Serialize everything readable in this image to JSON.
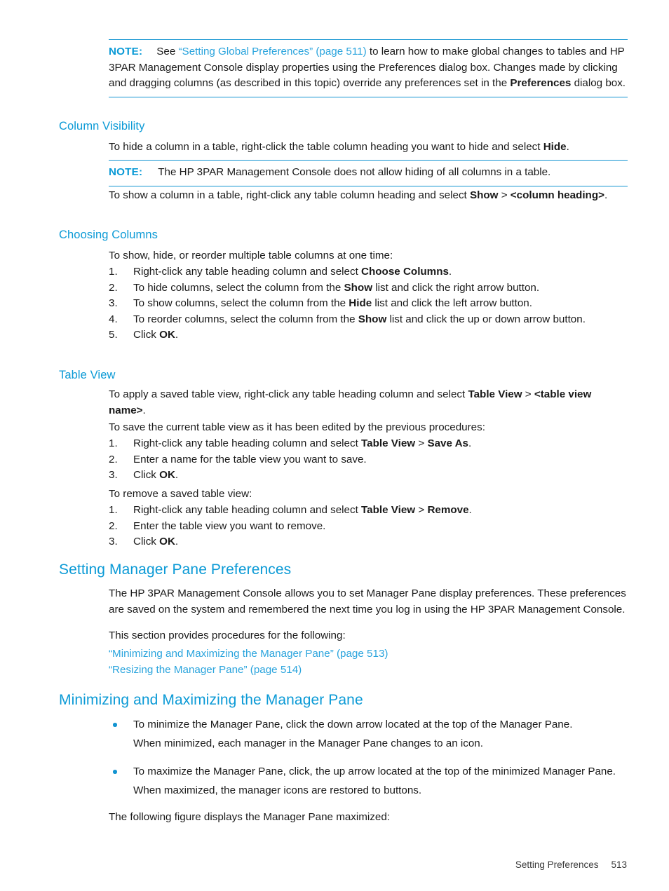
{
  "page": {
    "footer_section": "Setting Preferences",
    "footer_page_number": "513",
    "accent_blue": "#0b9ad6",
    "link_blue": "#2aa4dd",
    "rule_blue": "#1294d1"
  },
  "note_top": {
    "label": "NOTE:",
    "lead": "See ",
    "link": "“Setting Global Preferences” (page 511)",
    "rest": " to learn how to make global changes to tables and HP 3PAR Management Console display properties using the Preferences dialog box. Changes made by clicking and dragging columns (as described in this topic) override any preferences set in the ",
    "bold_term": "Preferences",
    "tail": " dialog box."
  },
  "column_visibility": {
    "heading": "Column Visibility",
    "para1_a": "To hide a column in a table, right-click the table column heading you want to hide and select ",
    "para1_bold": "Hide",
    "para1_b": ".",
    "note": {
      "label": "NOTE:",
      "text": "The HP 3PAR Management Console does not allow hiding of all columns in a table."
    },
    "para2_a": "To show a column in a table, right-click any table column heading and select ",
    "para2_bold1": "Show",
    "para2_mid": " > ",
    "para2_bold2": "<column heading>",
    "para2_b": "."
  },
  "choosing_columns": {
    "heading": "Choosing Columns",
    "intro": "To show, hide, or reorder multiple table columns at one time:",
    "steps": [
      {
        "num": "1.",
        "parts": [
          {
            "t": "Right-click any table heading column and select ",
            "b": false
          },
          {
            "t": "Choose Columns",
            "b": true
          },
          {
            "t": ".",
            "b": false
          }
        ]
      },
      {
        "num": "2.",
        "parts": [
          {
            "t": "To hide columns, select the column from the ",
            "b": false
          },
          {
            "t": "Show",
            "b": true
          },
          {
            "t": " list and click the right arrow button.",
            "b": false
          }
        ]
      },
      {
        "num": "3.",
        "parts": [
          {
            "t": "To show columns, select the column from the ",
            "b": false
          },
          {
            "t": "Hide",
            "b": true
          },
          {
            "t": " list and click the left arrow button.",
            "b": false
          }
        ]
      },
      {
        "num": "4.",
        "parts": [
          {
            "t": "To reorder columns, select the column from the ",
            "b": false
          },
          {
            "t": "Show",
            "b": true
          },
          {
            "t": " list and click the up or down arrow button.",
            "b": false
          }
        ]
      },
      {
        "num": "5.",
        "parts": [
          {
            "t": "Click ",
            "b": false
          },
          {
            "t": "OK",
            "b": true
          },
          {
            "t": ".",
            "b": false
          }
        ]
      }
    ]
  },
  "table_view": {
    "heading": "Table View",
    "para1_a": "To apply a saved table view, right-click any table heading column and select ",
    "para1_bold1": "Table View",
    "para1_mid": " > ",
    "para1_bold2": "<table view name>",
    "para1_b": ".",
    "save_intro": "To save the current table view as it has been edited by the previous procedures:",
    "save_steps": [
      {
        "num": "1.",
        "parts": [
          {
            "t": "Right-click any table heading column and select ",
            "b": false
          },
          {
            "t": "Table View",
            "b": true
          },
          {
            "t": " > ",
            "b": false
          },
          {
            "t": "Save As",
            "b": true
          },
          {
            "t": ".",
            "b": false
          }
        ]
      },
      {
        "num": "2.",
        "parts": [
          {
            "t": "Enter a name for the table view you want to save.",
            "b": false
          }
        ]
      },
      {
        "num": "3.",
        "parts": [
          {
            "t": "Click ",
            "b": false
          },
          {
            "t": "OK",
            "b": true
          },
          {
            "t": ".",
            "b": false
          }
        ]
      }
    ],
    "remove_intro": "To remove a saved table view:",
    "remove_steps": [
      {
        "num": "1.",
        "parts": [
          {
            "t": "Right-click any table heading column and select ",
            "b": false
          },
          {
            "t": "Table View",
            "b": true
          },
          {
            "t": " > ",
            "b": false
          },
          {
            "t": "Remove",
            "b": true
          },
          {
            "t": ".",
            "b": false
          }
        ]
      },
      {
        "num": "2.",
        "parts": [
          {
            "t": "Enter the table view you want to remove.",
            "b": false
          }
        ]
      },
      {
        "num": "3.",
        "parts": [
          {
            "t": "Click ",
            "b": false
          },
          {
            "t": "OK",
            "b": true
          },
          {
            "t": ".",
            "b": false
          }
        ]
      }
    ]
  },
  "manager_pane": {
    "heading": "Setting Manager Pane Preferences",
    "para1": "The HP 3PAR Management Console allows you to set Manager Pane display preferences. These preferences are saved on the system and remembered the next time you log in using the HP 3PAR Management Console.",
    "para2": "This section provides procedures for the following:",
    "links": [
      "“Minimizing and Maximizing the Manager Pane” (page 513)",
      "“Resizing the Manager Pane” (page 514)"
    ]
  },
  "minimizing": {
    "heading": "Minimizing and Maximizing the Manager Pane",
    "bullets": [
      {
        "line1": "To minimize the Manager Pane, click the down arrow located at the top of the Manager Pane.",
        "line2": "When minimized, each manager in the Manager Pane changes to an icon."
      },
      {
        "line1": "To maximize the Manager Pane, click, the up arrow located at the top of the minimized Manager Pane.",
        "line2": "When maximized, the manager icons are restored to buttons."
      }
    ],
    "closing": "The following figure displays the Manager Pane maximized:"
  }
}
